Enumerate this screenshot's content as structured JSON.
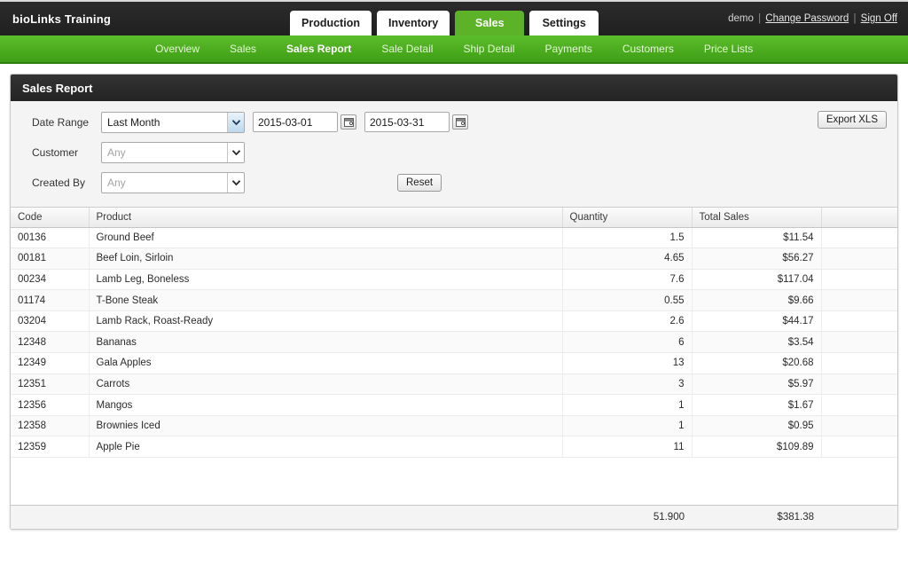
{
  "header": {
    "brand": "bioLinks Training",
    "tabs": [
      {
        "label": "Production",
        "active": false
      },
      {
        "label": "Inventory",
        "active": false
      },
      {
        "label": "Sales",
        "active": true
      },
      {
        "label": "Settings",
        "active": false
      }
    ],
    "user": {
      "name": "demo",
      "separator": "|",
      "change_password": "Change Password",
      "sign_off": "Sign Off"
    }
  },
  "subnav": {
    "items": [
      {
        "label": "Overview",
        "active": false
      },
      {
        "label": "Sales",
        "active": false
      },
      {
        "label": "Sales Report",
        "active": true
      },
      {
        "label": "Sale Detail",
        "active": false
      },
      {
        "label": "Ship Detail",
        "active": false
      },
      {
        "label": "Payments",
        "active": false
      },
      {
        "label": "Customers",
        "active": false
      },
      {
        "label": "Price Lists",
        "active": false
      }
    ]
  },
  "panel": {
    "title": "Sales Report"
  },
  "filters": {
    "date_range_label": "Date Range",
    "date_range_value": "Last Month",
    "date_from_value": "2015-03-01",
    "date_to_value": "2015-03-31",
    "customer_label": "Customer",
    "customer_value": "Any",
    "created_by_label": "Created By",
    "created_by_value": "Any",
    "reset_label": "Reset",
    "export_label": "Export XLS"
  },
  "table": {
    "columns": [
      "Code",
      "Product",
      "Quantity",
      "Total Sales"
    ],
    "rows": [
      {
        "code": "00136",
        "product": "Ground Beef",
        "quantity": "1.5",
        "total_sales": "$11.54"
      },
      {
        "code": "00181",
        "product": "Beef Loin, Sirloin",
        "quantity": "4.65",
        "total_sales": "$56.27"
      },
      {
        "code": "00234",
        "product": "Lamb Leg, Boneless",
        "quantity": "7.6",
        "total_sales": "$117.04"
      },
      {
        "code": "01174",
        "product": "T-Bone Steak",
        "quantity": "0.55",
        "total_sales": "$9.66"
      },
      {
        "code": "03204",
        "product": "Lamb Rack, Roast-Ready",
        "quantity": "2.6",
        "total_sales": "$44.17"
      },
      {
        "code": "12348",
        "product": "Bananas",
        "quantity": "6",
        "total_sales": "$3.54"
      },
      {
        "code": "12349",
        "product": "Gala Apples",
        "quantity": "13",
        "total_sales": "$20.68"
      },
      {
        "code": "12351",
        "product": "Carrots",
        "quantity": "3",
        "total_sales": "$5.97"
      },
      {
        "code": "12356",
        "product": "Mangos",
        "quantity": "1",
        "total_sales": "$1.67"
      },
      {
        "code": "12358",
        "product": "Brownies Iced",
        "quantity": "1",
        "total_sales": "$0.95"
      },
      {
        "code": "12359",
        "product": "Apple Pie",
        "quantity": "11",
        "total_sales": "$109.89"
      }
    ],
    "totals": {
      "quantity": "51.900",
      "total_sales": "$381.38"
    }
  },
  "colors": {
    "brand_green": "#5cb327",
    "dark_bar": "#262626",
    "panel_bg": "#f4f4f4"
  }
}
